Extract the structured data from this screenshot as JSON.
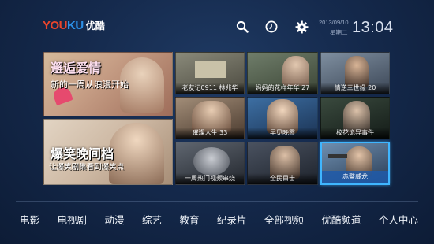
{
  "brand": {
    "logo_you": "YOU",
    "logo_ku": "KU",
    "logo_cn": "优酷"
  },
  "header": {
    "search_icon": "search-icon",
    "history_icon": "clock-icon",
    "settings_icon": "gear-icon",
    "date": "2013/09/10",
    "weekday": "星期二",
    "time": "13:04"
  },
  "featured": [
    {
      "title": "邂逅爱情",
      "subtitle": "新的一周从浪漫开始"
    },
    {
      "title": "爆笑晚间档",
      "subtitle": "让爆笑剧集看到爆笑点"
    }
  ],
  "tiles": [
    {
      "caption": "老友记0911 林兆华"
    },
    {
      "caption": "妈妈的花样年华 27"
    },
    {
      "caption": "情逆三世缘 20"
    },
    {
      "caption": "璀璨人生 33"
    },
    {
      "caption": "早见晚霞"
    },
    {
      "caption": "校花诡异事件"
    },
    {
      "caption": "一周热门视频串烧"
    },
    {
      "caption": "全民目击"
    },
    {
      "caption": "赤警威龙"
    }
  ],
  "nav": {
    "items": [
      "电影",
      "电视剧",
      "动漫",
      "综艺",
      "教育",
      "纪录片",
      "全部视频",
      "优酷频道",
      "个人中心"
    ]
  },
  "colors": {
    "accent": "#3fb6ff",
    "logo_red": "#e8452c",
    "logo_blue": "#2b8fe6"
  }
}
